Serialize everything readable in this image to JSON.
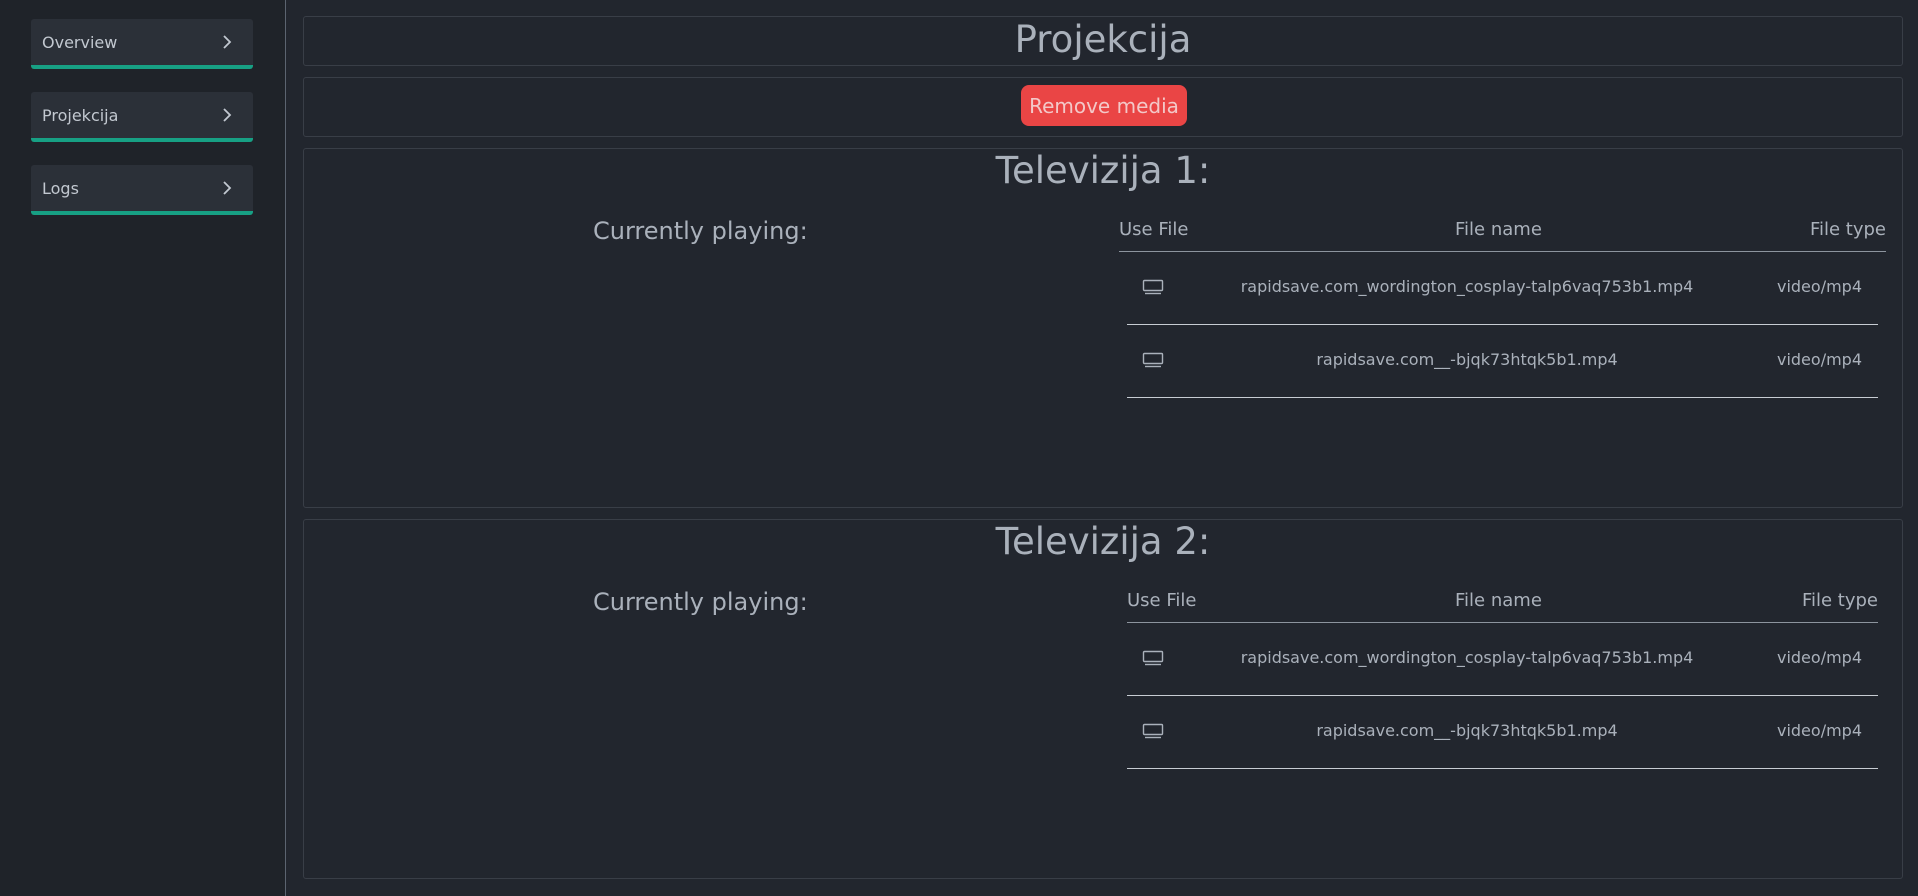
{
  "sidebar": {
    "items": [
      {
        "label": "Overview",
        "icon": "chevron-right-icon"
      },
      {
        "label": "Projekcija",
        "icon": "chevron-right-icon"
      },
      {
        "label": "Logs",
        "icon": "chevron-right-icon"
      }
    ]
  },
  "header": {
    "title": "Projekcija"
  },
  "actions": {
    "remove_label": "Remove media"
  },
  "televisions": [
    {
      "title": "Televizija 1:",
      "currently_playing_label": "Currently playing:",
      "columns": [
        "Use File",
        "File name",
        "File type"
      ],
      "files": [
        {
          "name": "rapidsave.com_wordington_cosplay-talp6vaq753b1.mp4",
          "type": "video/mp4"
        },
        {
          "name": "rapidsave.com__-bjqk73htqk5b1.mp4",
          "type": "video/mp4"
        }
      ]
    },
    {
      "title": "Televizija 2:",
      "currently_playing_label": "Currently playing:",
      "columns": [
        "Use File",
        "File name",
        "File type"
      ],
      "files": [
        {
          "name": "rapidsave.com_wordington_cosplay-talp6vaq753b1.mp4",
          "type": "video/mp4"
        },
        {
          "name": "rapidsave.com__-bjqk73htqk5b1.mp4",
          "type": "video/mp4"
        }
      ]
    }
  ],
  "colors": {
    "accent": "#17a084",
    "danger": "#ea4545",
    "background": "#22262e",
    "sidebar": "#1f2329"
  },
  "icons": {
    "use_file": "monitor-icon",
    "nav_chevron": "chevron-right-icon"
  }
}
